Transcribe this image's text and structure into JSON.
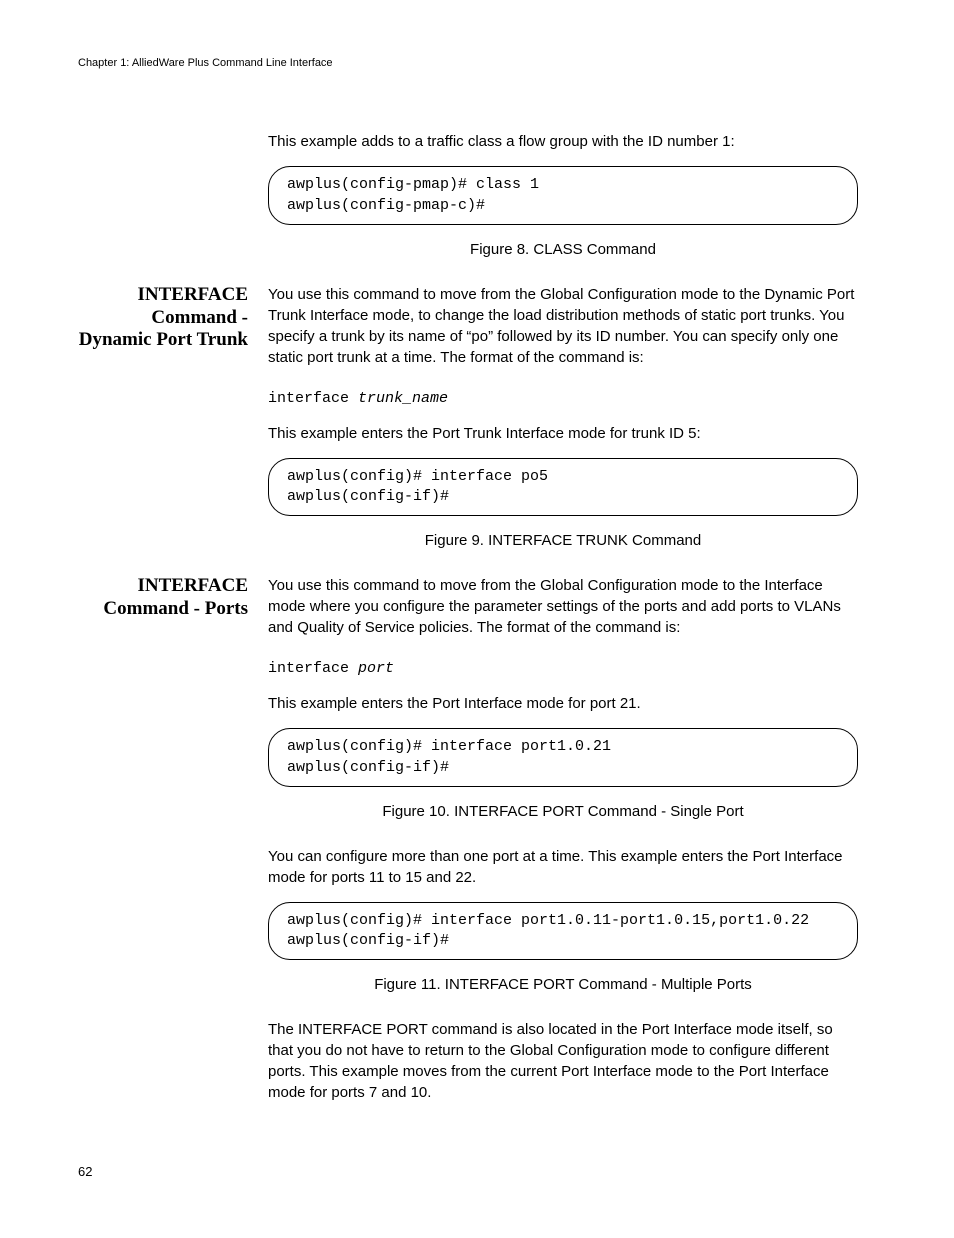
{
  "header": "Chapter 1: AlliedWare Plus Command Line Interface",
  "intro_para": "This example adds to a traffic class a flow group with the ID number 1:",
  "code_box_1": "awplus(config-pmap)# class 1\nawplus(config-pmap-c)#",
  "fig8": "Figure 8. CLASS Command",
  "section1": {
    "heading": "INTERFACE Command - Dynamic Port Trunk",
    "para1": "You use this command to move from the Global Configuration mode to the Dynamic Port Trunk Interface mode, to change the load distribution methods of static port trunks. You specify a trunk by its name of “po” followed by its ID number. You can specify only one static port trunk at a time. The format of the command is:",
    "cmd_prefix": "interface ",
    "cmd_arg": "trunk_name",
    "para2": "This example enters the Port Trunk Interface mode for trunk ID 5:",
    "code_box": "awplus(config)# interface po5\nawplus(config-if)#",
    "fig": "Figure 9. INTERFACE TRUNK Command"
  },
  "section2": {
    "heading": "INTERFACE Command - Ports",
    "para1": "You use this command to move from the Global Configuration mode to the Interface mode where you configure the parameter settings of the ports and add ports to VLANs and Quality of Service policies. The format of the command is:",
    "cmd_prefix": "interface ",
    "cmd_arg": "port",
    "para2": "This example enters the Port Interface mode for port 21.",
    "code_box1": "awplus(config)# interface port1.0.21\nawplus(config-if)#",
    "fig10": "Figure 10. INTERFACE PORT Command - Single Port",
    "para3": "You can configure more than one port at a time. This example enters the Port Interface mode for ports 11 to 15 and 22.",
    "code_box2": "awplus(config)# interface port1.0.11-port1.0.15,port1.0.22\nawplus(config-if)#",
    "fig11": "Figure 11. INTERFACE PORT Command - Multiple Ports",
    "para4": "The INTERFACE PORT command is also located in the Port Interface mode itself, so that you do not have to return to the Global Configuration mode to configure different ports. This example moves from the current Port Interface mode to the Port Interface mode for ports 7 and 10."
  },
  "page_number": "62"
}
